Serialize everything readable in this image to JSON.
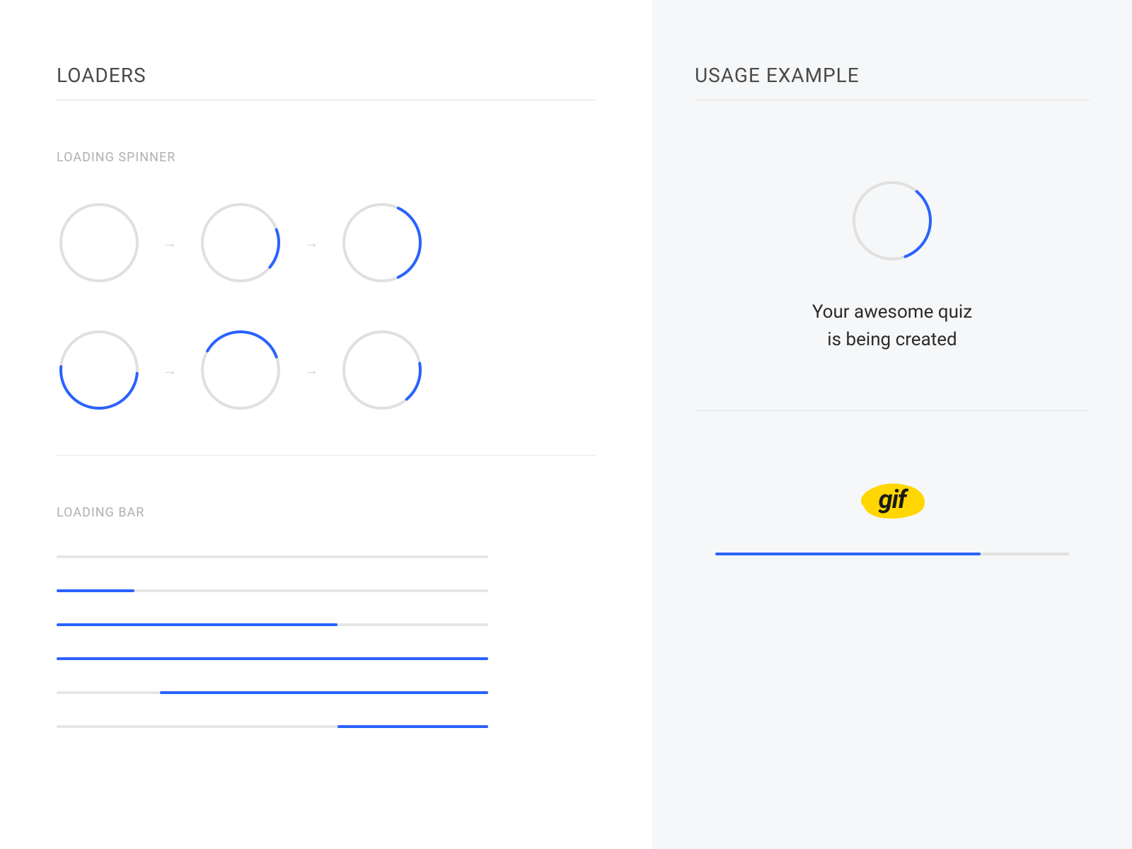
{
  "left": {
    "title": "LOADERS",
    "spinner_section": {
      "title": "LOADING SPINNER",
      "spinners": [
        {
          "arc_start": 0,
          "arc_length": 0
        },
        {
          "arc_start": 70,
          "arc_length": 60
        },
        {
          "arc_start": 25,
          "arc_length": 130
        },
        {
          "arc_start": 95,
          "arc_length": 180
        },
        {
          "arc_start": 300,
          "arc_length": 130
        },
        {
          "arc_start": 80,
          "arc_length": 60
        }
      ]
    },
    "bar_section": {
      "title": "LOADING BAR",
      "bars": [
        {
          "start_pct": 0,
          "width_pct": 0
        },
        {
          "start_pct": 0,
          "width_pct": 18
        },
        {
          "start_pct": 0,
          "width_pct": 65
        },
        {
          "start_pct": 0,
          "width_pct": 100
        },
        {
          "start_pct": 24,
          "width_pct": 76
        },
        {
          "start_pct": 65,
          "width_pct": 35
        }
      ]
    }
  },
  "right": {
    "title": "USAGE EXAMPLE",
    "spinner": {
      "arc_start": 40,
      "arc_length": 120
    },
    "message_line1": "Your awesome quiz",
    "message_line2": "is being created",
    "gif_label": "gif",
    "gif_progress_pct": 75
  },
  "colors": {
    "accent": "#2962ff",
    "track": "#e0e0e0",
    "yellow": "#ffd600"
  }
}
